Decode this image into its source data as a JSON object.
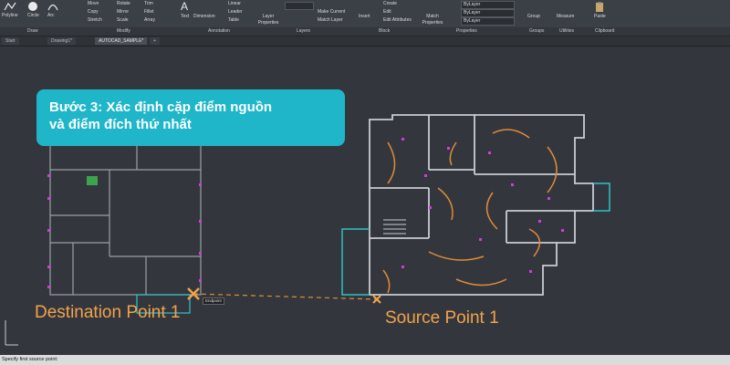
{
  "ribbon": {
    "tools_draw": [
      "Polyline",
      "Circle",
      "Arc"
    ],
    "tools_modify": [
      "Move",
      "Rotate",
      "Trim",
      "Copy",
      "Mirror",
      "Fillet",
      "Stretch",
      "Scale",
      "Array"
    ],
    "tools_annotation": [
      "Text",
      "Dimension",
      "Linear",
      "Leader",
      "Table"
    ],
    "tools_layers": [
      "Layer Properties",
      "Make Current",
      "Match Layer"
    ],
    "tools_block": [
      "Insert",
      "Create",
      "Edit",
      "Edit Attributes"
    ],
    "tools_properties": [
      "Match Properties",
      "ByLayer",
      "ByLayer",
      "ByLayer"
    ],
    "tools_groups": [
      "Group"
    ],
    "tools_utilities": [
      "Measure"
    ],
    "tools_clipboard": [
      "Paste"
    ],
    "panels": [
      "Draw",
      "Modify",
      "Annotation",
      "Layers",
      "Block",
      "Properties",
      "Groups",
      "Utilities",
      "Clipboard"
    ]
  },
  "tabs": [
    "Start",
    "Drawing1*",
    "AUTOCAD_SAMPLE*",
    "+"
  ],
  "callout": {
    "line1": "Bước 3: Xác định cặp điểm nguồn",
    "line2": "và điểm đích thứ nhất"
  },
  "labels": {
    "destination": "Destination Point 1",
    "source": "Source Point 1",
    "snap_tooltip": "Endpoint"
  },
  "command_line": "Specify first source point:",
  "colors": {
    "accent": "#1fb6c9",
    "point": "#f2a34b",
    "walls": "#c9ccd1",
    "door_swing": "#e08a3a",
    "marker": "#d23bd8",
    "cyan_lines": "#2ec4c4"
  }
}
